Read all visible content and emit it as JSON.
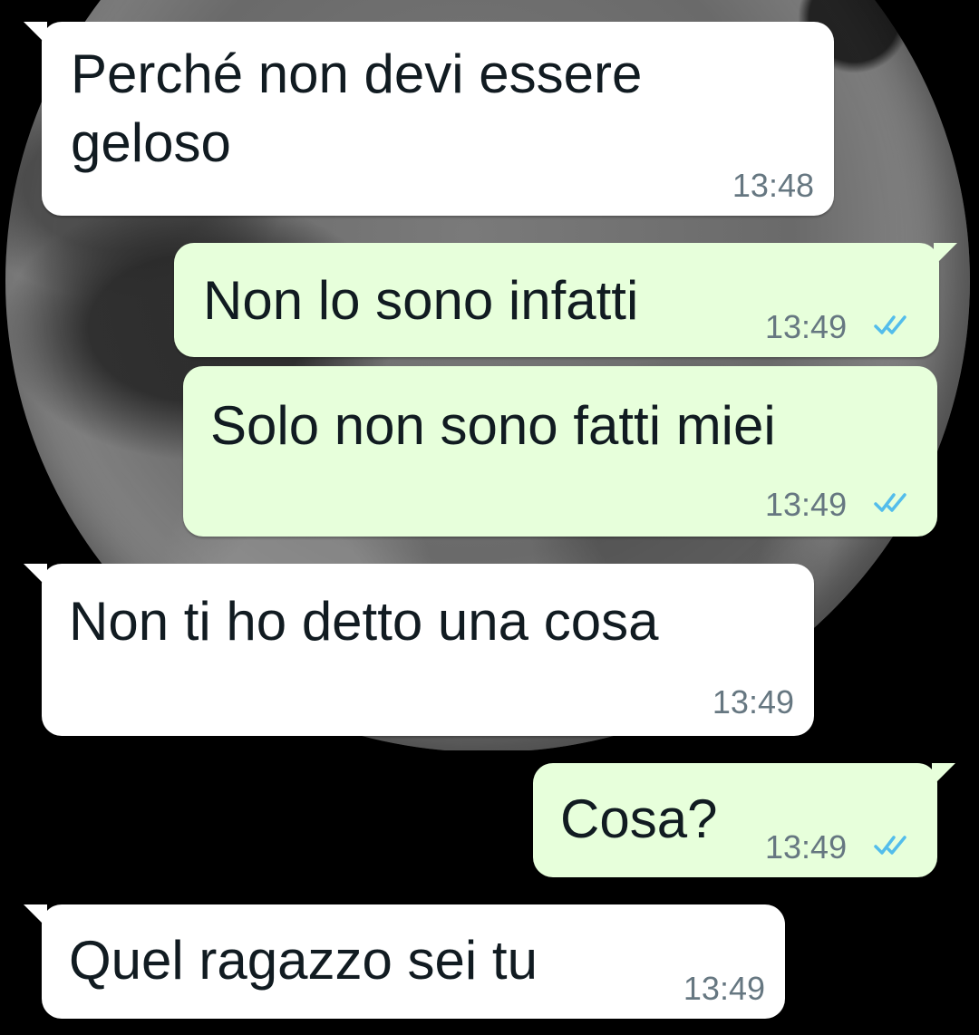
{
  "chat": {
    "messages": [
      {
        "direction": "in",
        "text": "Perché non devi essere\ngeloso",
        "time": "13:48"
      },
      {
        "direction": "out",
        "text": "Non lo sono infatti",
        "time": "13:49",
        "status": "read"
      },
      {
        "direction": "out",
        "text": "Solo non sono fatti miei",
        "time": "13:49",
        "status": "read"
      },
      {
        "direction": "in",
        "text": "Non ti ho detto una cosa",
        "time": "13:49"
      },
      {
        "direction": "out",
        "text": "Cosa?",
        "time": "13:49",
        "status": "read"
      },
      {
        "direction": "in",
        "text": "Quel ragazzo sei tu",
        "time": "13:49"
      }
    ]
  },
  "colors": {
    "incoming_bubble": "#ffffff",
    "outgoing_bubble": "#e7ffdb",
    "read_ticks": "#53bdeb",
    "timestamp": "#667781"
  },
  "icons": {
    "read_receipt": "double-check-icon"
  }
}
